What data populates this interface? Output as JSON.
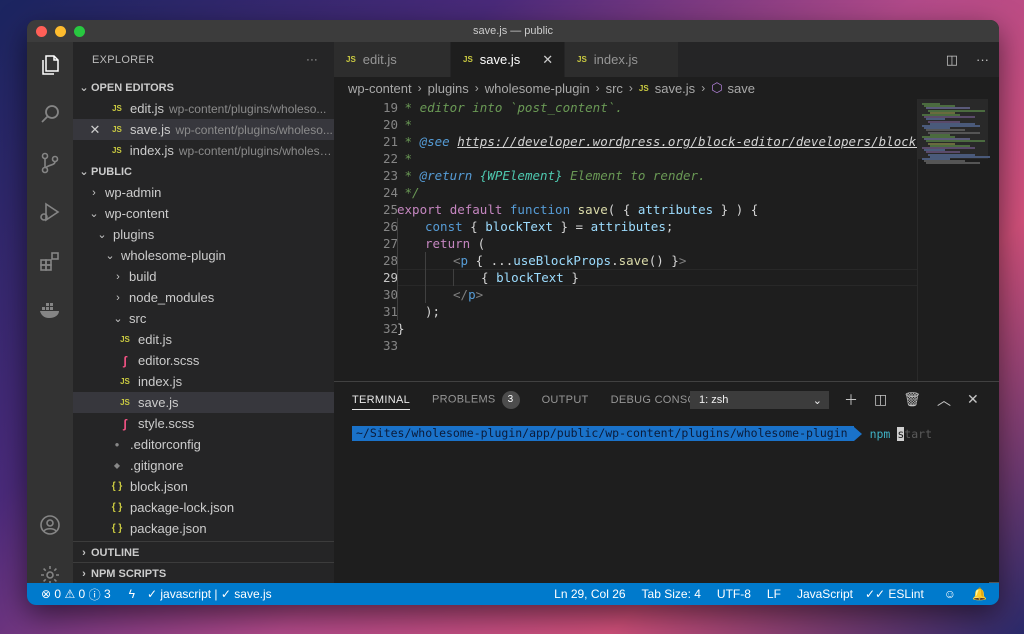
{
  "window": {
    "title": "save.js — public"
  },
  "activity_bar": {
    "icons": [
      "files-icon",
      "search-icon",
      "source-control-icon",
      "run-debug-icon",
      "extensions-icon",
      "docker-icon",
      "account-icon",
      "settings-gear-icon"
    ]
  },
  "explorer": {
    "title": "EXPLORER",
    "more": "···",
    "open_editors": {
      "label": "OPEN EDITORS",
      "items": [
        {
          "name": "edit.js",
          "path": "wp-content/plugins/wholeso..."
        },
        {
          "name": "save.js",
          "path": "wp-content/plugins/wholeso..."
        },
        {
          "name": "index.js",
          "path": "wp-content/plugins/wholeso..."
        }
      ]
    },
    "folder": {
      "label": "PUBLIC",
      "items": [
        {
          "name": "wp-admin",
          "kind": "folder",
          "expanded": false
        },
        {
          "name": "wp-content",
          "kind": "folder",
          "expanded": true
        },
        {
          "name": "plugins",
          "kind": "folder",
          "expanded": true
        },
        {
          "name": "wholesome-plugin",
          "kind": "folder",
          "expanded": true
        },
        {
          "name": "build",
          "kind": "folder",
          "expanded": false
        },
        {
          "name": "node_modules",
          "kind": "folder",
          "expanded": false
        },
        {
          "name": "src",
          "kind": "folder",
          "expanded": true
        },
        {
          "name": "edit.js",
          "kind": "js"
        },
        {
          "name": "editor.scss",
          "kind": "scss"
        },
        {
          "name": "index.js",
          "kind": "js"
        },
        {
          "name": "save.js",
          "kind": "js",
          "selected": true
        },
        {
          "name": "style.scss",
          "kind": "scss"
        },
        {
          "name": ".editorconfig",
          "kind": "config"
        },
        {
          "name": ".gitignore",
          "kind": "git"
        },
        {
          "name": "block.json",
          "kind": "json"
        },
        {
          "name": "package-lock.json",
          "kind": "json"
        },
        {
          "name": "package.json",
          "kind": "json"
        }
      ]
    },
    "outline": "OUTLINE",
    "npm_scripts": "NPM SCRIPTS"
  },
  "tabs": [
    {
      "label": "edit.js",
      "active": false
    },
    {
      "label": "save.js",
      "active": true
    },
    {
      "label": "index.js",
      "active": false
    }
  ],
  "breadcrumb": [
    "wp-content",
    "plugins",
    "wholesome-plugin",
    "src",
    "save.js",
    "save"
  ],
  "code": {
    "current_line": 29,
    "lines": [
      {
        "n": 19,
        "text": " * editor into `post_content`."
      },
      {
        "n": 20,
        "text": " *"
      },
      {
        "n": 21,
        "text": " * @see https://developer.wordpress.org/block-editor/developers/block-api/b"
      },
      {
        "n": 22,
        "text": " *"
      },
      {
        "n": 23,
        "text": " * @return {WPElement} Element to render."
      },
      {
        "n": 24,
        "text": " */"
      },
      {
        "n": 25,
        "text": "export default function save( { attributes } ) {"
      },
      {
        "n": 26,
        "text": "\tconst { blockText } = attributes;"
      },
      {
        "n": 27,
        "text": "\treturn ("
      },
      {
        "n": 28,
        "text": "\t\t<p { ...useBlockProps.save() }>"
      },
      {
        "n": 29,
        "text": "\t\t\t{ blockText }"
      },
      {
        "n": 30,
        "text": "\t\t</p>"
      },
      {
        "n": 31,
        "text": "\t);"
      },
      {
        "n": 32,
        "text": "}"
      },
      {
        "n": 33,
        "text": ""
      }
    ]
  },
  "panel": {
    "tabs": [
      "TERMINAL",
      "PROBLEMS",
      "OUTPUT",
      "DEBUG CONSOLE"
    ],
    "problems_count": "3",
    "terminal_select": "1: zsh",
    "prompt_path": "~/Sites/wholesome-plugin/app/public/wp-content/plugins/wholesome-plugin",
    "command": "npm",
    "cursor_char": "s",
    "suggestion": "tart"
  },
  "statusbar": {
    "errors": "0",
    "warnings": "0",
    "info": "3",
    "lint_js": "javascript |",
    "lint_file": "save.js",
    "position": "Ln 29, Col 26",
    "tab_size": "Tab Size: 4",
    "encoding": "UTF-8",
    "eol": "LF",
    "language": "JavaScript",
    "eslint": "ESLint"
  }
}
